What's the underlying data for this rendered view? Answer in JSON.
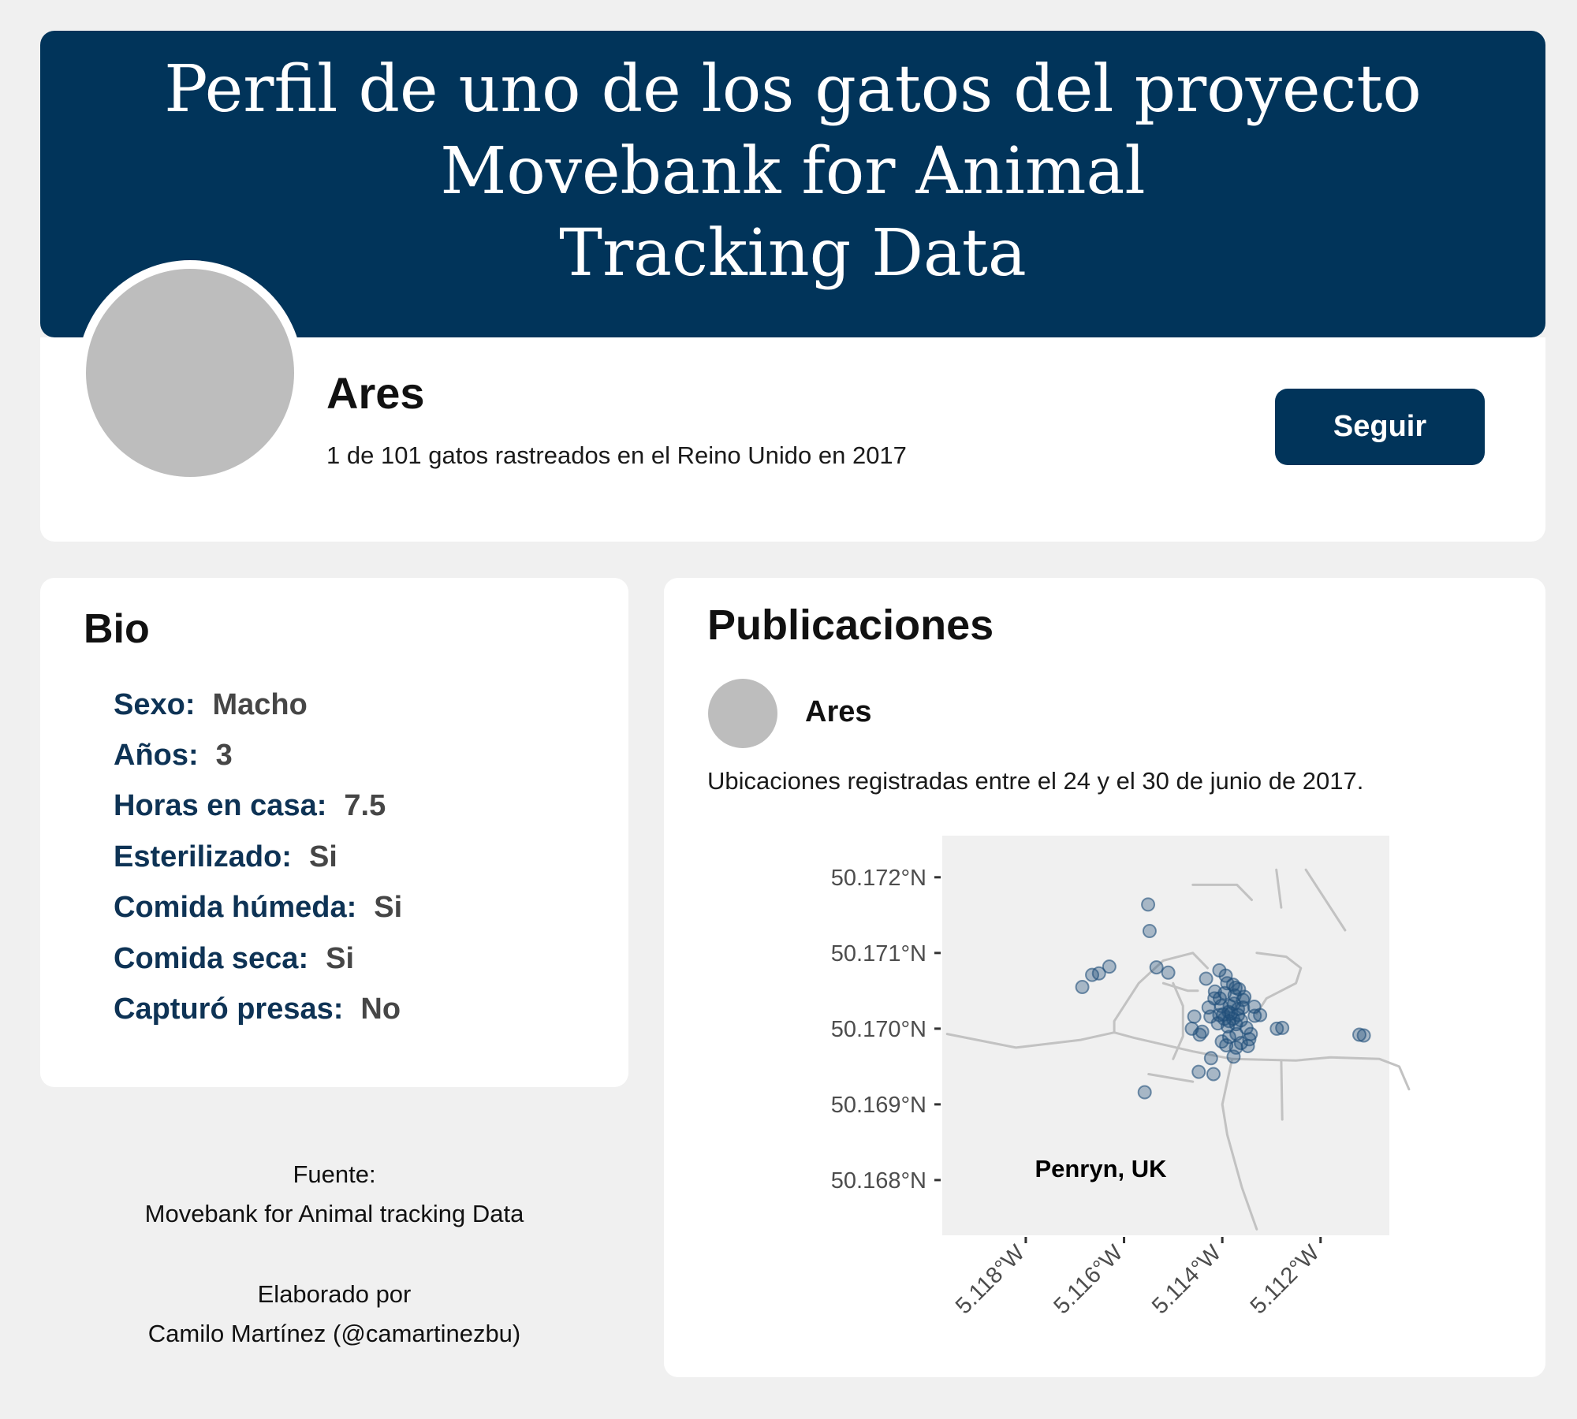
{
  "header": {
    "title": "Perfil de uno de los gatos del proyecto\nMovebank for Animal\nTracking Data"
  },
  "profile": {
    "name": "Ares",
    "subtitle": "1 de 101 gatos rastreados en el Reino Unido en 2017",
    "follow_label": "Seguir"
  },
  "bio": {
    "title": "Bio",
    "rows": [
      {
        "label": "Sexo:",
        "value": "Macho"
      },
      {
        "label": "Años:",
        "value": "3"
      },
      {
        "label": "Horas en casa:",
        "value": "7.5"
      },
      {
        "label": "Esterilizado:",
        "value": "Si"
      },
      {
        "label": "Comida húmeda:",
        "value": "Si"
      },
      {
        "label": "Comida seca:",
        "value": "Si"
      },
      {
        "label": "Capturó presas:",
        "value": "No"
      }
    ]
  },
  "footer": {
    "source_label": "Fuente:",
    "source": "Movebank for Animal tracking Data",
    "credit_label": "Elaborado por",
    "credit": "Camilo Martínez (@camartinezbu)"
  },
  "publications": {
    "title": "Publicaciones",
    "author": "Ares",
    "text": "Ubicaciones registradas entre el 24 y el 30 de junio de 2017."
  },
  "colors": {
    "navy": "#01345a",
    "point": "#1f4e79",
    "road": "#c2c2c2",
    "panel": "#f0f0f0"
  },
  "chart_data": {
    "type": "scatter",
    "title": "",
    "xlabel": "",
    "ylabel": "",
    "annotation": "Penryn, UK",
    "x_ticks": [
      {
        "value": -5.118,
        "label": "5.118°W"
      },
      {
        "value": -5.116,
        "label": "5.116°W"
      },
      {
        "value": -5.114,
        "label": "5.114°W"
      },
      {
        "value": -5.112,
        "label": "5.112°W"
      }
    ],
    "y_ticks": [
      {
        "value": 50.172,
        "label": "50.172°N"
      },
      {
        "value": 50.171,
        "label": "50.171°N"
      },
      {
        "value": 50.17,
        "label": "50.170°N"
      },
      {
        "value": 50.169,
        "label": "50.169°N"
      },
      {
        "value": 50.168,
        "label": "50.168°N"
      }
    ],
    "xlim": [
      -5.1197,
      -5.1106
    ],
    "ylim": [
      50.16727,
      50.17255
    ],
    "points": [
      [
        -5.11551,
        50.17164
      ],
      [
        -5.11548,
        50.17129
      ],
      [
        -5.1163,
        50.17082
      ],
      [
        -5.11651,
        50.17073
      ],
      [
        -5.11665,
        50.17071
      ],
      [
        -5.11685,
        50.17055
      ],
      [
        -5.11534,
        50.17081
      ],
      [
        -5.1151,
        50.17074
      ],
      [
        -5.11433,
        50.17066
      ],
      [
        -5.11457,
        50.17016
      ],
      [
        -5.11441,
        50.16996
      ],
      [
        -5.11462,
        50.17
      ],
      [
        -5.11446,
        50.16992
      ],
      [
        -5.11423,
        50.16961
      ],
      [
        -5.11448,
        50.16943
      ],
      [
        -5.11418,
        50.1694
      ],
      [
        -5.11558,
        50.16916
      ],
      [
        -5.11373,
        50.17054
      ],
      [
        -5.11335,
        50.17029
      ],
      [
        -5.11323,
        50.17018
      ],
      [
        -5.11289,
        50.17
      ],
      [
        -5.11278,
        50.17001
      ],
      [
        -5.11348,
        50.16977
      ],
      [
        -5.11377,
        50.16963
      ],
      [
        -5.11345,
        50.16986
      ],
      [
        -5.11358,
        50.17028
      ],
      [
        -5.11406,
        50.17077
      ],
      [
        -5.11393,
        50.1707
      ],
      [
        -5.1139,
        50.1706
      ],
      [
        -5.11395,
        50.17047
      ],
      [
        -5.11385,
        50.1703
      ],
      [
        -5.11402,
        50.1703
      ],
      [
        -5.11416,
        50.1704
      ],
      [
        -5.11382,
        50.1702
      ],
      [
        -5.11368,
        50.17018
      ],
      [
        -5.11355,
        50.17042
      ],
      [
        -5.11372,
        50.17006
      ],
      [
        -5.11389,
        50.17003
      ],
      [
        -5.11409,
        50.17007
      ],
      [
        -5.11424,
        50.17016
      ],
      [
        -5.11428,
        50.17028
      ],
      [
        -5.11406,
        50.17018
      ],
      [
        -5.11396,
        50.17013
      ],
      [
        -5.11386,
        50.1701
      ],
      [
        -5.11376,
        50.17033
      ],
      [
        -5.11362,
        50.17011
      ],
      [
        -5.11351,
        50.17001
      ],
      [
        -5.11342,
        50.16993
      ],
      [
        -5.11371,
        50.16993
      ],
      [
        -5.11386,
        50.16989
      ],
      [
        -5.11401,
        50.16983
      ],
      [
        -5.11392,
        50.16978
      ],
      [
        -5.11372,
        50.16975
      ],
      [
        -5.11362,
        50.16981
      ],
      [
        -5.11334,
        50.17017
      ],
      [
        -5.11415,
        50.17049
      ],
      [
        -5.11405,
        50.1704
      ],
      [
        -5.11375,
        50.17044
      ],
      [
        -5.11366,
        50.17052
      ],
      [
        -5.11378,
        50.17058
      ],
      [
        -5.11398,
        50.17019
      ],
      [
        -5.11387,
        50.17022
      ],
      [
        -5.11378,
        50.17013
      ],
      [
        -5.11368,
        50.17026
      ],
      [
        -5.11358,
        50.17038
      ],
      [
        -5.11121,
        50.16992
      ],
      [
        -5.11112,
        50.16991
      ]
    ],
    "roads": [
      [
        [
          -5.1196,
          50.16993
        ],
        [
          -5.1182,
          50.16975
        ],
        [
          -5.1169,
          50.16985
        ],
        [
          -5.1162,
          50.16995
        ],
        [
          -5.1158,
          50.16988
        ],
        [
          -5.1146,
          50.1697
        ],
        [
          -5.1138,
          50.1696
        ],
        [
          -5.1125,
          50.16958
        ],
        [
          -5.1118,
          50.16962
        ],
        [
          -5.1108,
          50.1696
        ],
        [
          -5.1104,
          50.1695
        ],
        [
          -5.1102,
          50.1692
        ]
      ],
      [
        [
          -5.1162,
          50.16995
        ],
        [
          -5.1162,
          50.1701
        ],
        [
          -5.1157,
          50.1706
        ],
        [
          -5.1152,
          50.1709
        ],
        [
          -5.1146,
          50.171
        ],
        [
          -5.1143,
          50.1708
        ]
      ],
      [
        [
          -5.1152,
          50.1706
        ],
        [
          -5.1147,
          50.1705
        ],
        [
          -5.1145,
          50.1705
        ]
      ],
      [
        [
          -5.1138,
          50.1696
        ],
        [
          -5.114,
          50.169
        ],
        [
          -5.1139,
          50.1686
        ],
        [
          -5.1136,
          50.1679
        ],
        [
          -5.1133,
          50.16735
        ]
      ],
      [
        [
          -5.1128,
          50.16958
        ],
        [
          -5.11278,
          50.1688
        ]
      ],
      [
        [
          -5.1155,
          50.1694
        ],
        [
          -5.1146,
          50.1693
        ]
      ],
      [
        [
          -5.1146,
          50.1719
        ],
        [
          -5.1137,
          50.1719
        ],
        [
          -5.1134,
          50.1717
        ]
      ],
      [
        [
          -5.1129,
          50.1721
        ],
        [
          -5.1128,
          50.1716
        ]
      ],
      [
        [
          -5.1123,
          50.1721
        ],
        [
          -5.1115,
          50.1713
        ]
      ],
      [
        [
          -5.1133,
          50.171
        ],
        [
          -5.1127,
          50.17095
        ],
        [
          -5.1124,
          50.1708
        ],
        [
          -5.1125,
          50.1706
        ],
        [
          -5.1131,
          50.1704
        ],
        [
          -5.1133,
          50.1702
        ]
      ],
      [
        [
          -5.115,
          50.1696
        ],
        [
          -5.1148,
          50.1699
        ],
        [
          -5.1148,
          50.1703
        ],
        [
          -5.115,
          50.1706
        ]
      ]
    ]
  }
}
